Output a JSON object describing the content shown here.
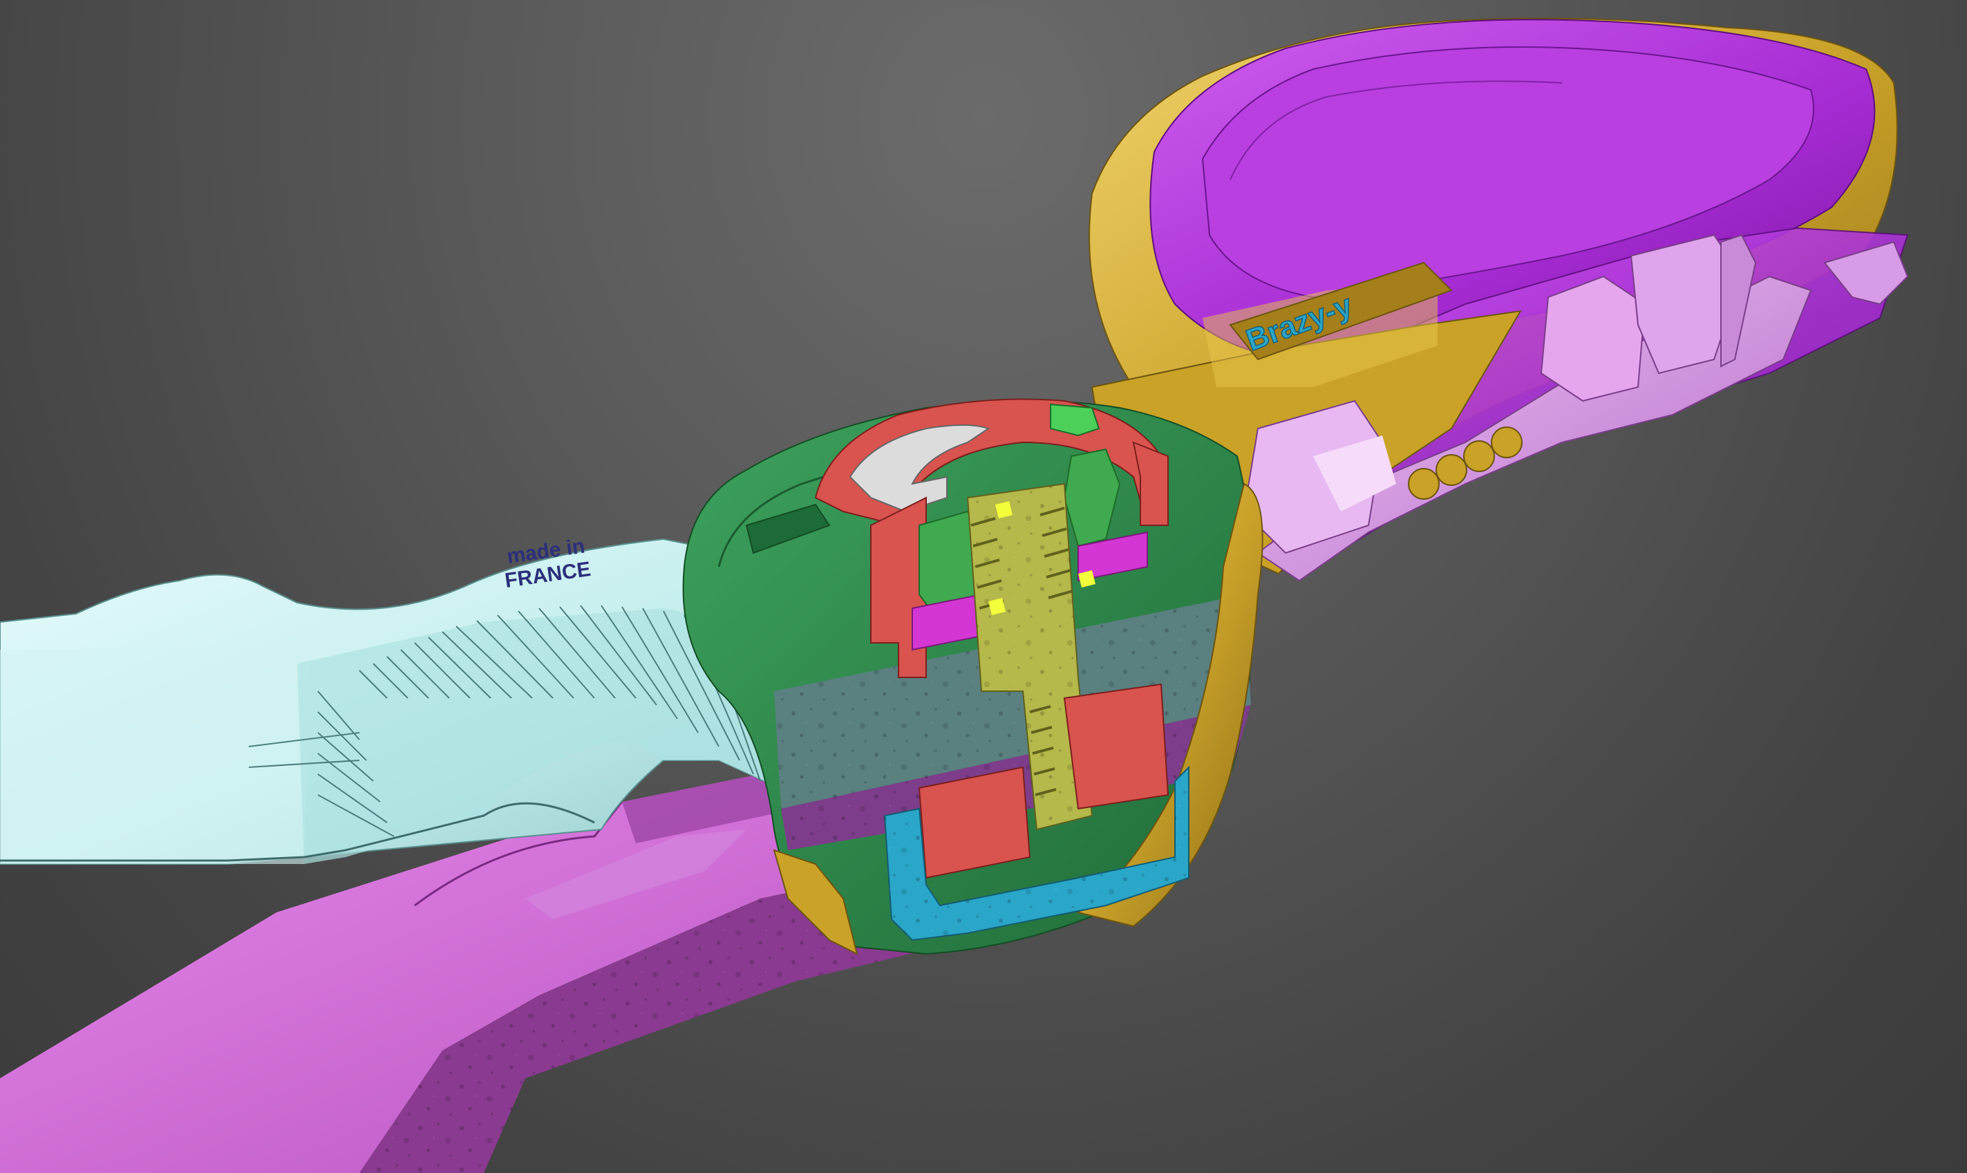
{
  "viewport": {
    "background": "#555555",
    "colors": {
      "blade_upper": "#bfeeee",
      "blade_lower": "#d86fd8",
      "cap_green": "#2e8b4a",
      "cap_red": "#d9534f",
      "screw_olive": "#b5b84a",
      "housing_purple": "#9b59b6",
      "housing_blue": "#2aa6c9",
      "handle_gold": "#c9a227",
      "handle_violet": "#b23ed6",
      "lever_pink": "#d89be6"
    }
  },
  "engravings": {
    "blade_line1": "made in",
    "blade_line2": "FRANCE",
    "handle_brand": "Brazy-y"
  }
}
